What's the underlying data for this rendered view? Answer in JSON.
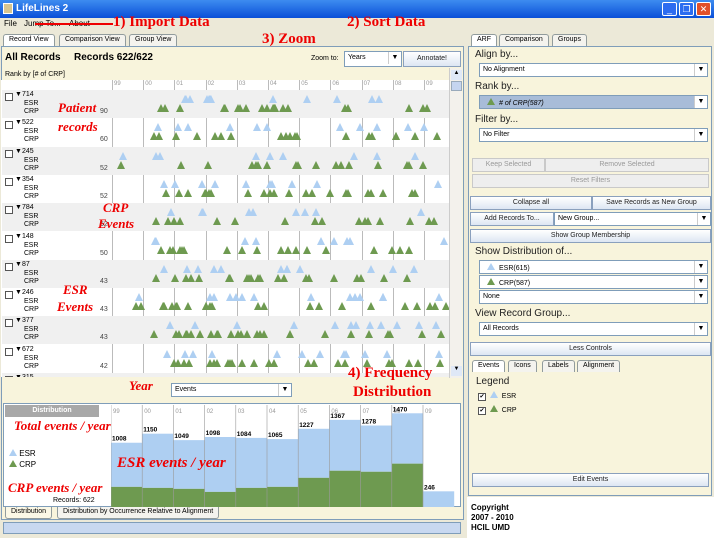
{
  "window": {
    "title": "LifeLines 2"
  },
  "menu": [
    "File",
    "Jump To...",
    "About"
  ],
  "left_tabs": [
    "Record View",
    "Comparison View",
    "Group View"
  ],
  "header": {
    "title": "All Records",
    "records": "Records 622/622",
    "zoom_label": "Zoom to:",
    "zoom_value": "Years",
    "annotate": "Annotate!",
    "rank_by": "Rank by [# of CRP]"
  },
  "years": [
    "99",
    "00",
    "01",
    "02",
    "03",
    "04",
    "05",
    "06",
    "07",
    "08",
    "09"
  ],
  "records": [
    {
      "id": "714",
      "count": "90",
      "events": [
        "ESR",
        "CRP"
      ]
    },
    {
      "id": "522",
      "count": "60",
      "events": [
        "ESR",
        "CRP"
      ]
    },
    {
      "id": "245",
      "count": "52",
      "events": [
        "ESR",
        "CRP"
      ]
    },
    {
      "id": "354",
      "count": "52",
      "events": [
        "ESR",
        "CRP"
      ]
    },
    {
      "id": "784",
      "count": "52",
      "events": [
        "ESR",
        "CRP"
      ]
    },
    {
      "id": "148",
      "count": "50",
      "events": [
        "ESR",
        "CRP"
      ]
    },
    {
      "id": "87",
      "count": "43",
      "events": [
        "ESR",
        "CRP"
      ]
    },
    {
      "id": "246",
      "count": "43",
      "events": [
        "ESR",
        "CRP"
      ]
    },
    {
      "id": "377",
      "count": "43",
      "events": [
        "ESR",
        "CRP"
      ]
    },
    {
      "id": "672",
      "count": "42",
      "events": [
        "ESR",
        "CRP"
      ]
    },
    {
      "id": "315",
      "count": "",
      "events": []
    }
  ],
  "distribution": {
    "mode": "Events",
    "title": "Distribution",
    "legend": [
      "ESR",
      "CRP"
    ],
    "records_label": "Records: 622",
    "tabs": [
      "Distribution",
      "Distribution by Occurrence Relative to Alignment"
    ]
  },
  "colors": {
    "esr": "#aecff2",
    "crp": "#6e9a50",
    "accent": "#e00000"
  },
  "chart_data": {
    "type": "bar",
    "stacked": true,
    "categories": [
      "99",
      "00",
      "01",
      "02",
      "03",
      "04",
      "05",
      "06",
      "07",
      "08",
      "09"
    ],
    "totals": [
      1008,
      1150,
      1049,
      1098,
      1084,
      1065,
      1227,
      1367,
      1278,
      1470,
      246
    ],
    "series": [
      {
        "name": "CRP",
        "values": [
          316,
          300,
          285,
          237,
          300,
          316,
          458,
          569,
          553,
          680,
          0
        ]
      },
      {
        "name": "ESR",
        "values": [
          692,
          850,
          764,
          861,
          784,
          749,
          769,
          798,
          725,
          790,
          246
        ]
      }
    ]
  },
  "right": {
    "tabs": [
      "ARF",
      "Comparison",
      "Groups"
    ],
    "align_label": "Align by...",
    "align_value": "No Alignment",
    "rank_label": "Rank by...",
    "rank_value": "# of CRP(587)",
    "filter_label": "Filter by...",
    "filter_value": "No Filter",
    "keep": "Keep Selected",
    "remove": "Remove Selected",
    "reset": "Reset Filters",
    "collapse": "Collapse all",
    "save_group": "Save Records as New Group",
    "add_to": "Add Records To...",
    "new_group": "New Group...",
    "show_membership": "Show Group Membership",
    "dist_label": "Show Distribution of...",
    "dist_values": [
      "ESR(615)",
      "CRP(587)",
      "None"
    ],
    "view_group_label": "View Record Group...",
    "view_group_value": "All Records",
    "less_controls": "Less Controls",
    "bottom_tabs": [
      "Events",
      "Icons",
      "Labels",
      "Alignment"
    ],
    "legend_title": "Legend",
    "legend_items": [
      "ESR",
      "CRP"
    ],
    "edit_events": "Edit Events",
    "copyright": [
      "Copyright",
      "2007 - 2010",
      "HCIL  UMD"
    ]
  },
  "annotations": {
    "import": "1) Import Data",
    "sort": "2) Sort Data",
    "zoom": "3) Zoom",
    "freq1": "4) Frequency",
    "freq2": "Distribution",
    "patient1": "Patient",
    "patient2": "records",
    "crp1": "CRP",
    "crp2": "Events",
    "esr1": "ESR",
    "esr2": "Events",
    "year": "Year",
    "total": "Total events / year",
    "esr_year": "ESR events / year",
    "crp_year": "CRP events / year"
  }
}
